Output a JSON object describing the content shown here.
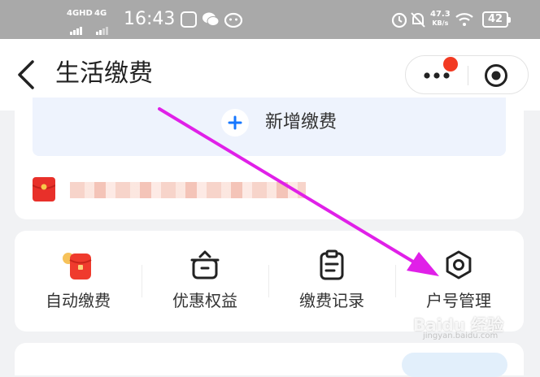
{
  "status_bar": {
    "sim1": "4GHD",
    "sim2": "4G",
    "time": "16:43",
    "speed_value": "47.3",
    "speed_unit": "KB/s",
    "battery": "42",
    "app_icons": [
      "message-app-icon",
      "wechat-icon",
      "cat-app-icon"
    ],
    "system_icons": [
      "alarm-icon",
      "mute-bell-icon",
      "wifi-icon"
    ]
  },
  "header": {
    "title": "生活缴费",
    "back_icon": "back-chevron-icon",
    "more_icon": "more-dots-icon",
    "target_icon": "target-icon",
    "notify_color": "#f23a22"
  },
  "card1": {
    "add_label": "新增缴费",
    "plus_icon": "plus-icon",
    "accent": "#1677ff"
  },
  "functions": [
    {
      "label": "自动缴费",
      "icon": "auto-pay-icon"
    },
    {
      "label": "优惠权益",
      "icon": "gift-box-icon"
    },
    {
      "label": "缴费记录",
      "icon": "clipboard-icon"
    },
    {
      "label": "户号管理",
      "icon": "gear-icon"
    }
  ],
  "annotation": {
    "arrow_color": "#e020e8"
  },
  "watermark": {
    "text": "Baidu 经验",
    "sub": "jingyan.baidu.com"
  }
}
